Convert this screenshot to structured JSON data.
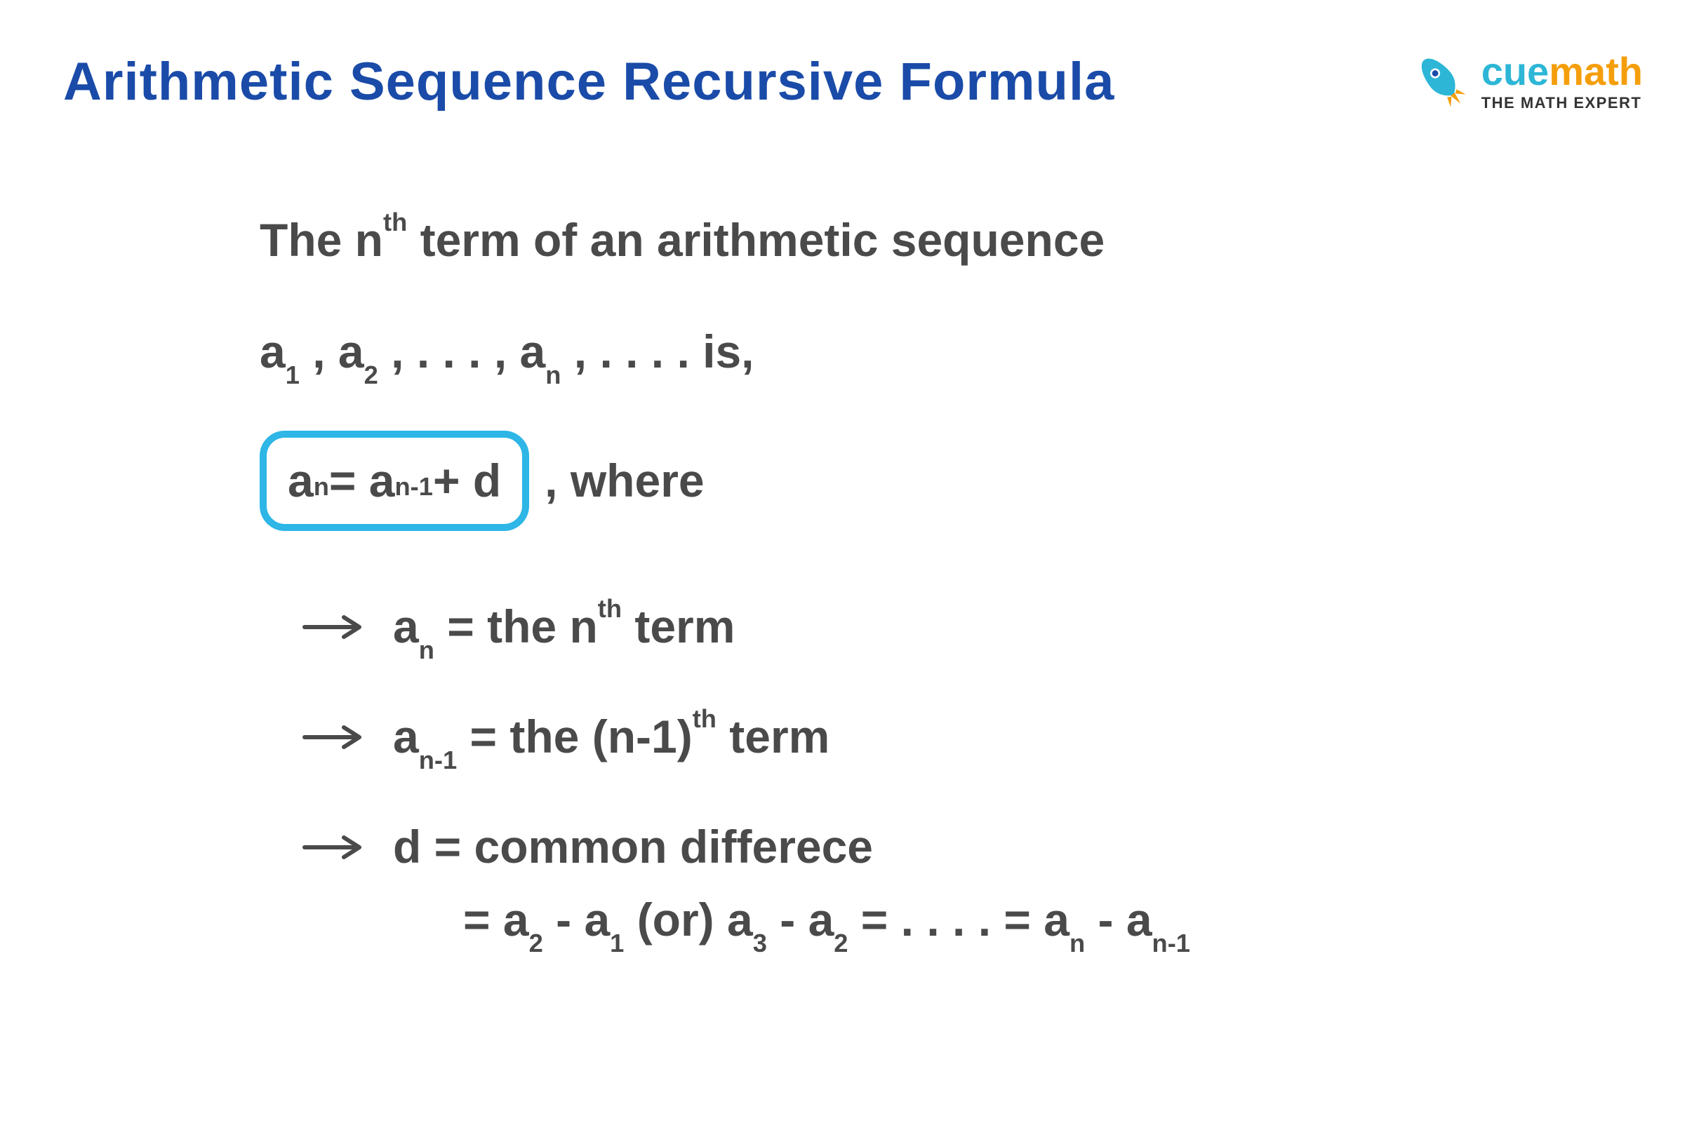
{
  "title": "Arithmetic Sequence Recursive Formula",
  "logo": {
    "brand_cue": "cue",
    "brand_math": "math",
    "tagline": "THE MATH EXPERT"
  },
  "content": {
    "line1_prefix": "The n",
    "line1_sup": "th",
    "line1_suffix": " term of an arithmetic sequence",
    "line2": {
      "a1_base": "a",
      "a1_sub": "1",
      "sep1": " , ",
      "a2_base": "a",
      "a2_sub": "2",
      "sep2": " , . . . , ",
      "an_base": "a",
      "an_sub": "n",
      "sep3": " , . . . .   is,"
    },
    "formula": {
      "lhs_base": "a",
      "lhs_sub": "n",
      "eq": " = ",
      "rhs_base": "a",
      "rhs_sub": "n-1",
      "plus": " + d"
    },
    "where": ",  where",
    "bullets": {
      "b1": {
        "lhs_base": "a",
        "lhs_sub": "n",
        "eq": " =  the n",
        "sup": "th",
        "suffix": " term"
      },
      "b2": {
        "lhs_base": "a",
        "lhs_sub": "n-1",
        "eq": "  =  the (n-1)",
        "sup": "th",
        "suffix": " term"
      },
      "b3": {
        "lhs": "d  =  common differece",
        "second": {
          "eq": "=  ",
          "a2_base": "a",
          "a2_sub": "2",
          "minus1": " - ",
          "a1_base": "a",
          "a1_sub": "1",
          "or": " (or) ",
          "a3_base": "a",
          "a3_sub": "3",
          "minus2": " - ",
          "a2b_base": "a",
          "a2b_sub": "2",
          "mid": " = . . . . =  ",
          "an_base": "a",
          "an_sub": "n",
          "minus3": " - ",
          "anm1_base": "a",
          "anm1_sub": "n-1"
        }
      }
    }
  }
}
